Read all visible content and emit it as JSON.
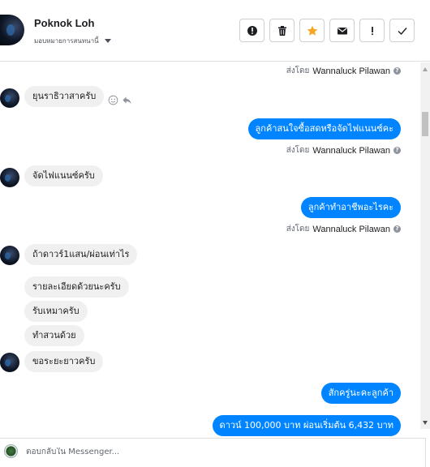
{
  "header": {
    "contact_name": "Poknok Loh",
    "assign_label": "มอบหมายการสนทนานี้",
    "actions": [
      {
        "name": "report-button",
        "icon": "exclamation-circle-icon"
      },
      {
        "name": "delete-button",
        "icon": "trash-icon"
      },
      {
        "name": "star-button",
        "icon": "star-icon",
        "color": "#f5a623"
      },
      {
        "name": "mark-unread-button",
        "icon": "envelope-icon"
      },
      {
        "name": "spam-button",
        "icon": "exclamation-icon"
      },
      {
        "name": "mark-done-button",
        "icon": "checkmark-icon"
      }
    ]
  },
  "thread": {
    "sent_by_prefix": "ส่งโดย",
    "sender": "Wannaluck Pilawan",
    "messages": [
      {
        "dir": "in",
        "text": "ยุนราธิวาสาครับ"
      },
      {
        "dir": "out",
        "text": "ลูกค้าสนใจซื้อสดหรือจัดไฟแนนซ์คะ"
      },
      {
        "dir": "in",
        "text": "จัดไฟแนนซ์ครับ"
      },
      {
        "dir": "out",
        "text": "ลูกค้าทำอาชีพอะไรคะ"
      },
      {
        "dir": "in",
        "text": "ถ้าดาวร์1แสน/ผ่อนเท่าไร"
      },
      {
        "dir": "in",
        "text": "รายละเอียดด้วยนะครับ"
      },
      {
        "dir": "in",
        "text": "รับเหมาครับ"
      },
      {
        "dir": "in",
        "text": "ทำสวนด้วย"
      },
      {
        "dir": "in",
        "text": "ขอระยะยาวครับ"
      },
      {
        "dir": "out",
        "text": "สักครู่นะคะลูกค้า"
      },
      {
        "dir": "out",
        "text": "ดาวน์ 100,000 บาท ผ่อนเริ่มต้น 6,432 บาท"
      }
    ]
  },
  "composer": {
    "placeholder": "ตอบกลับใน Messenger..."
  },
  "colors": {
    "outgoing_bubble": "#0084ff",
    "incoming_bubble": "#f1f0f0",
    "star": "#f5a623"
  }
}
